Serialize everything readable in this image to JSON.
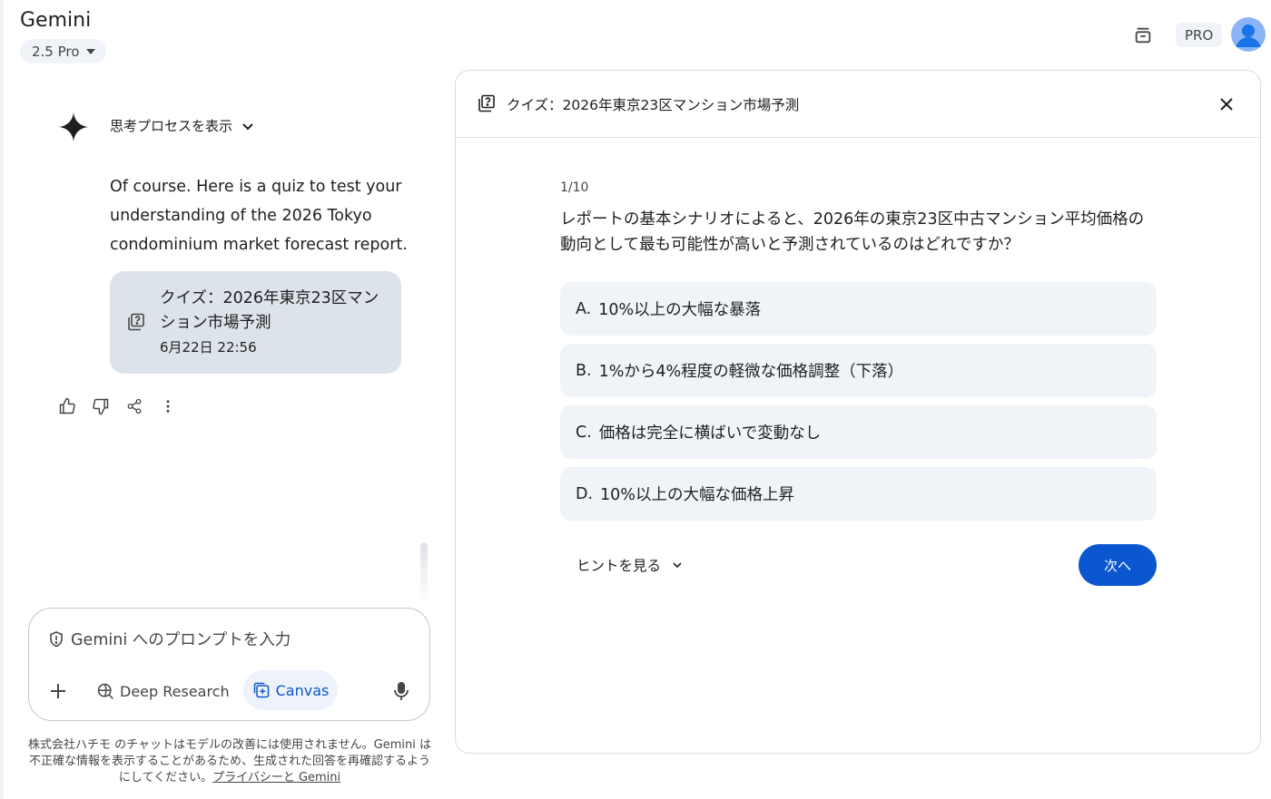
{
  "header": {
    "app_title": "Gemini",
    "model": "2.5 Pro",
    "pro_badge": "PRO"
  },
  "chat": {
    "thinking_toggle": "思考プロセスを表示",
    "response_text": "Of course. Here is a quiz to test your understanding of the 2026 Tokyo condominium market forecast report.",
    "quiz_card": {
      "title": "クイズ：2026年東京23区マンション市場予測",
      "date": "6月22日 22:56"
    },
    "actions": [
      "thumbs-up-icon",
      "thumbs-down-icon",
      "share-icon",
      "more-vert-icon"
    ]
  },
  "prompt": {
    "placeholder": "Gemini へのプロンプトを入力",
    "tools": {
      "deep_research": "Deep Research",
      "canvas": "Canvas"
    }
  },
  "disclaimer": {
    "text": "株式会社ハチモ のチャットはモデルの改善には使用されません。Gemini は不正確な情報を表示することがあるため、生成された回答を再確認するようにしてください。",
    "link": "プライバシーと Gemini"
  },
  "canvas": {
    "title": "クイズ：2026年東京23区マンション市場予測",
    "progress": "1/10",
    "question": "レポートの基本シナリオによると、2026年の東京23区中古マンション平均価格の動向として最も可能性が高いと予測されているのはどれですか？",
    "options": [
      {
        "letter": "A.",
        "text": "10%以上の大幅な暴落"
      },
      {
        "letter": "B.",
        "text": "1%から4%程度の軽微な価格調整（下落）"
      },
      {
        "letter": "C.",
        "text": "価格は完全に横ばいで変動なし"
      },
      {
        "letter": "D.",
        "text": "10%以上の大幅な価格上昇"
      }
    ],
    "hint_label": "ヒントを見る",
    "next_label": "次へ"
  },
  "colors": {
    "accent": "#0b57d0",
    "card_bg": "#dde3ea",
    "option_bg": "#f0f4f9"
  }
}
